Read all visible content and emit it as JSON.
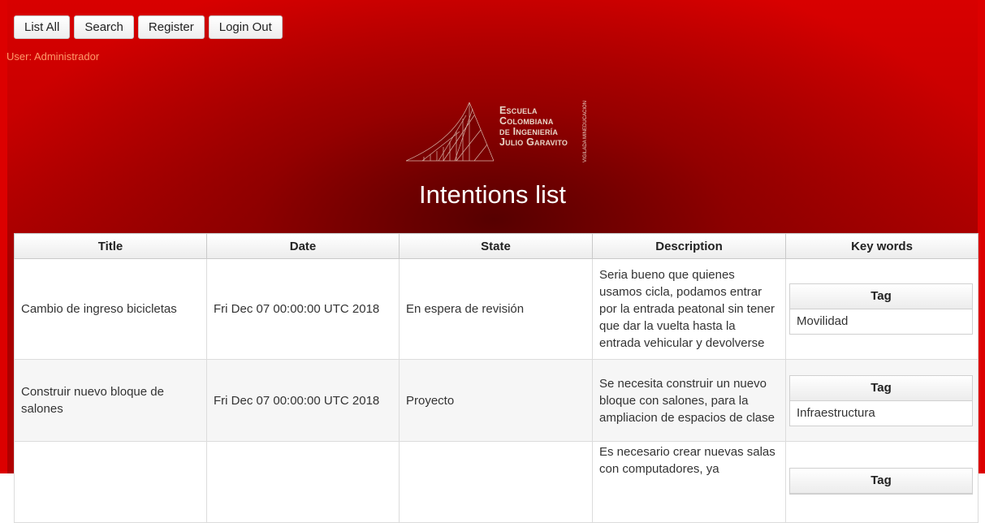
{
  "nav": {
    "buttons": [
      "List All",
      "Search",
      "Register",
      "Login Out"
    ]
  },
  "user_label": "User: Administrador",
  "logo": {
    "lines": [
      "Escuela",
      "Colombiana",
      "de Ingeniería",
      "Julio Garavito"
    ],
    "side_text": "VIGILADA MINEDUCACIÓN"
  },
  "page_title": "Intentions list",
  "table": {
    "headers": [
      "Title",
      "Date",
      "State",
      "Description",
      "Key words"
    ],
    "tag_header": "Tag",
    "rows": [
      {
        "title": "Cambio de ingreso bicicletas",
        "date": "Fri Dec 07 00:00:00 UTC 2018",
        "state": "En espera de revisión",
        "description": "Seria bueno que quienes usamos cicla, podamos entrar por la entrada peatonal sin tener que dar la vuelta hasta la entrada vehicular y devolverse",
        "tag": "Movilidad"
      },
      {
        "title": "Construir nuevo bloque de salones",
        "date": "Fri Dec 07 00:00:00 UTC 2018",
        "state": "Proyecto",
        "description": "Se necesita construir un nuevo bloque con salones, para la ampliacion de espacios de clase",
        "tag": "Infraestructura"
      },
      {
        "title": "",
        "date": "",
        "state": "",
        "description": "Es necesario crear nuevas salas con computadores, ya",
        "tag": ""
      }
    ]
  },
  "colors": {
    "background_red": "#c40000",
    "user_label": "#ff9a6a"
  }
}
